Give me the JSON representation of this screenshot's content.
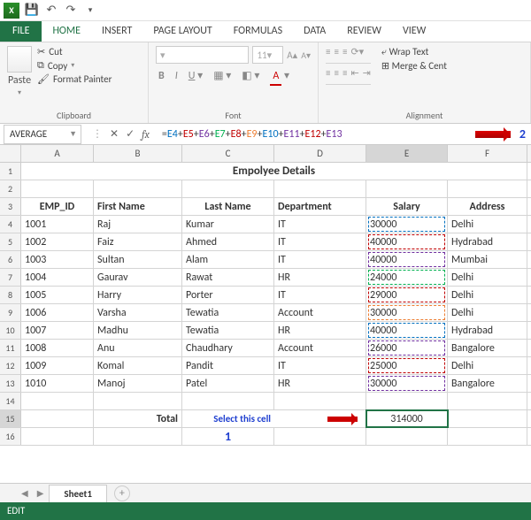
{
  "qat": {
    "save_tip": "Save",
    "undo_tip": "Undo",
    "redo_tip": "Redo"
  },
  "tabs": {
    "file": "FILE",
    "home": "HOME",
    "insert": "INSERT",
    "page": "PAGE LAYOUT",
    "formulas": "FORMULAS",
    "data": "DATA",
    "review": "REVIEW",
    "view": "VIEW"
  },
  "ribbon": {
    "paste": "Paste",
    "cut": "Cut",
    "copy": "Copy",
    "fmtpainter": "Format Painter",
    "clipboard": "Clipboard",
    "font_group": "Font",
    "font_size": "11",
    "align_group": "Alignment",
    "wrap": "Wrap Text",
    "merge": "Merge & Cent"
  },
  "formula_bar": {
    "namebox": "AVERAGE",
    "formula_tokens": [
      "=",
      "E4",
      "+",
      "E5",
      "+",
      "E6",
      "+",
      "E7",
      "+",
      "E8",
      "+",
      "E9",
      "+",
      "E10",
      "+",
      "E11",
      "+",
      "E12",
      "+",
      "E13"
    ],
    "callout2": "2"
  },
  "columns": [
    "A",
    "B",
    "C",
    "D",
    "E",
    "F"
  ],
  "selected_col": "E",
  "title": "Empolyee Details",
  "headers": {
    "a": "EMP_ID",
    "b": "First Name",
    "c": "Last Name",
    "d": "Department",
    "e": "Salary",
    "f": "Address"
  },
  "rows": [
    {
      "id": "1001",
      "fn": "Raj",
      "ln": "Kumar",
      "dept": "IT",
      "sal": "30000",
      "addr": "Delhi"
    },
    {
      "id": "1002",
      "fn": "Faiz",
      "ln": "Ahmed",
      "dept": "IT",
      "sal": "40000",
      "addr": "Hydrabad"
    },
    {
      "id": "1003",
      "fn": "Sultan",
      "ln": "Alam",
      "dept": "IT",
      "sal": "40000",
      "addr": "Mumbai"
    },
    {
      "id": "1004",
      "fn": "Gaurav",
      "ln": "Rawat",
      "dept": "HR",
      "sal": "24000",
      "addr": "Delhi"
    },
    {
      "id": "1005",
      "fn": "Harry",
      "ln": "Porter",
      "dept": "IT",
      "sal": "29000",
      "addr": "Delhi"
    },
    {
      "id": "1006",
      "fn": "Varsha",
      "ln": "Tewatia",
      "dept": "Account",
      "sal": "30000",
      "addr": "Delhi"
    },
    {
      "id": "1007",
      "fn": "Madhu",
      "ln": "Tewatia",
      "dept": "HR",
      "sal": "40000",
      "addr": "Hydrabad"
    },
    {
      "id": "1008",
      "fn": "Anu",
      "ln": "Chaudhary",
      "dept": "Account",
      "sal": "26000",
      "addr": "Bangalore"
    },
    {
      "id": "1009",
      "fn": "Komal",
      "ln": "Pandit",
      "dept": "IT",
      "sal": "25000",
      "addr": "Delhi"
    },
    {
      "id": "1010",
      "fn": "Manoj",
      "ln": "Patel",
      "dept": "HR",
      "sal": "30000",
      "addr": "Bangalore"
    }
  ],
  "total_label": "Total",
  "select_hint": "Select this cell",
  "total_value": "314000",
  "callout1": "1",
  "sheet": "Sheet1",
  "status": "EDIT",
  "marq_colors": [
    "c0",
    "c1",
    "c2",
    "c3",
    "c4",
    "c5",
    "c6",
    "c7",
    "c8",
    "c9"
  ]
}
